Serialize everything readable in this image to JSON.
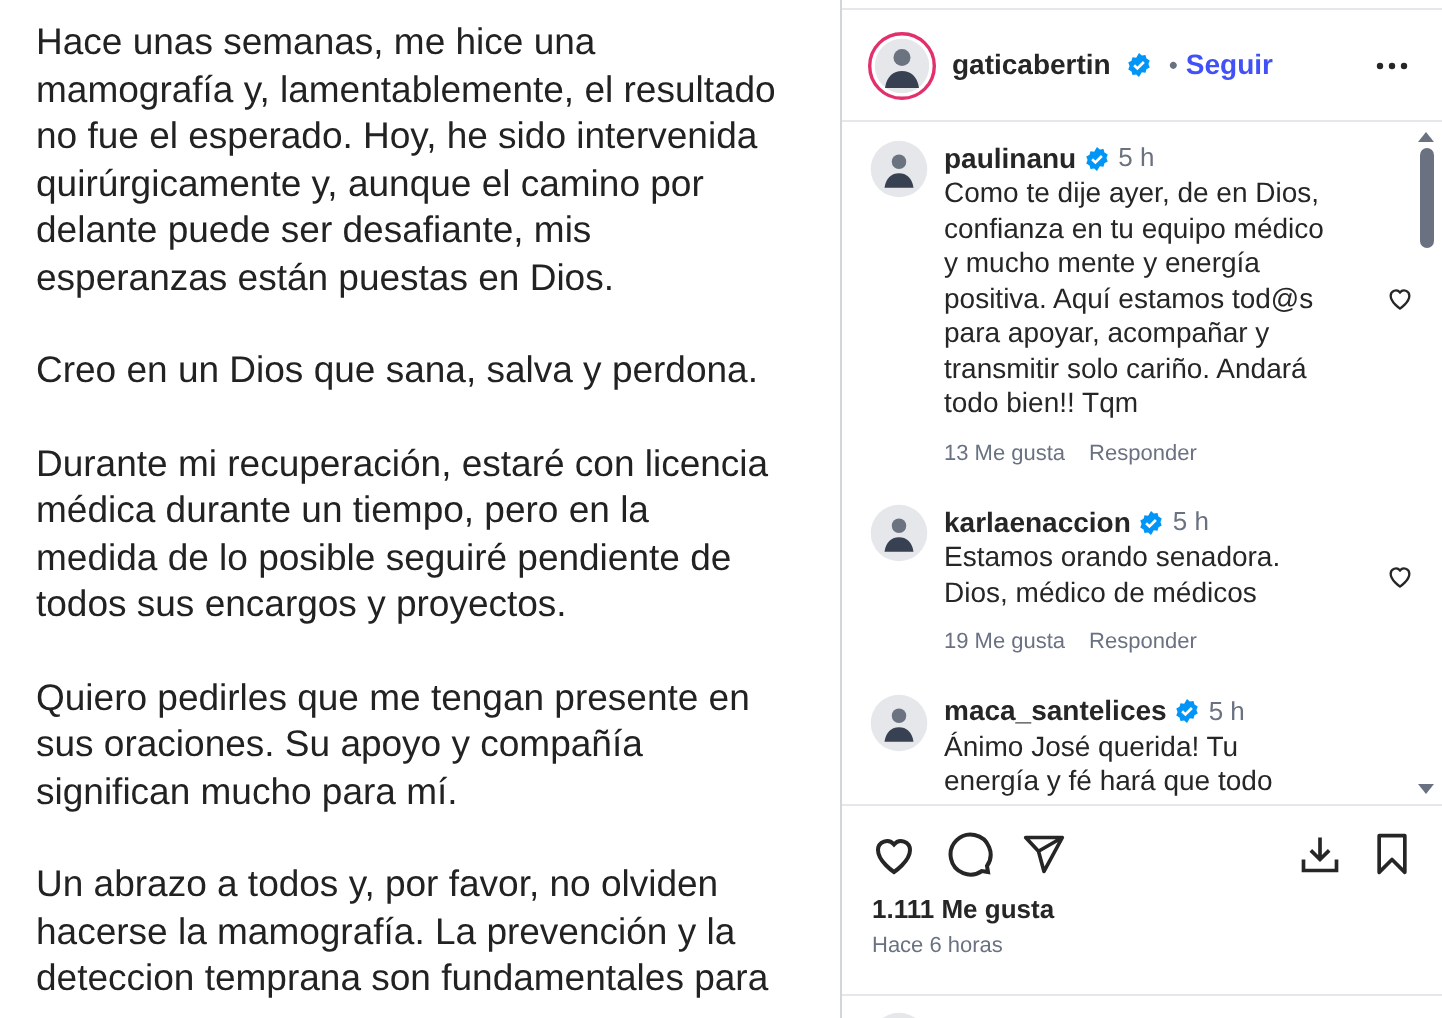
{
  "post_text": {
    "paragraphs": [
      [
        "Hace unas semanas, me hice una",
        "mamografía y, lamentablemente, el resultado",
        "no fue el esperado. Hoy, he sido intervenida",
        "quirúrgicamente y, aunque el camino por",
        "delante puede ser desafiante, mis",
        "esperanzas están puestas en Dios."
      ],
      [
        "Creo en un Dios que sana, salva y perdona."
      ],
      [
        "Durante mi recuperación, estaré con licencia",
        "médica durante un tiempo,  pero en la",
        "medida de lo posible seguiré pendiente de",
        "todos sus encargos y proyectos."
      ],
      [
        "Quiero pedirles que me tengan presente en",
        "sus oraciones. Su apoyo y compañía",
        "significan mucho para mí."
      ],
      [
        "Un abrazo a todos y, por favor, no olviden",
        "hacerse la mamografía. La prevención y la",
        "deteccion temprana son fundamentales para"
      ]
    ]
  },
  "header": {
    "username": "gaticabertin",
    "verified": true,
    "separator": "•",
    "follow": "Seguir"
  },
  "comments": [
    {
      "username": "paulinanu",
      "verified": true,
      "time": "5 h",
      "lines": [
        "Como te dije ayer, de en Dios,",
        "confianza en tu equipo médico",
        "y mucho mente y energía",
        "positiva. Aquí estamos tod@s",
        "para apoyar, acompañar y",
        "transmitir solo cariño. Andará",
        "todo bien!! Tqm"
      ],
      "likes": "13 Me gusta",
      "reply": "Responder",
      "liked": false
    },
    {
      "username": "karlaenaccion",
      "verified": true,
      "time": "5 h",
      "lines": [
        "Estamos orando senadora.",
        "Dios, médico de médicos"
      ],
      "likes": "19 Me gusta",
      "reply": "Responder",
      "liked": false
    },
    {
      "username": "maca_santelices",
      "verified": true,
      "time": "5 h",
      "lines": [
        "Ánimo José querida! Tu",
        "energía y fé hará que todo"
      ]
    }
  ],
  "likes": "1.111 Me gusta",
  "posted": "Hace 6 horas"
}
